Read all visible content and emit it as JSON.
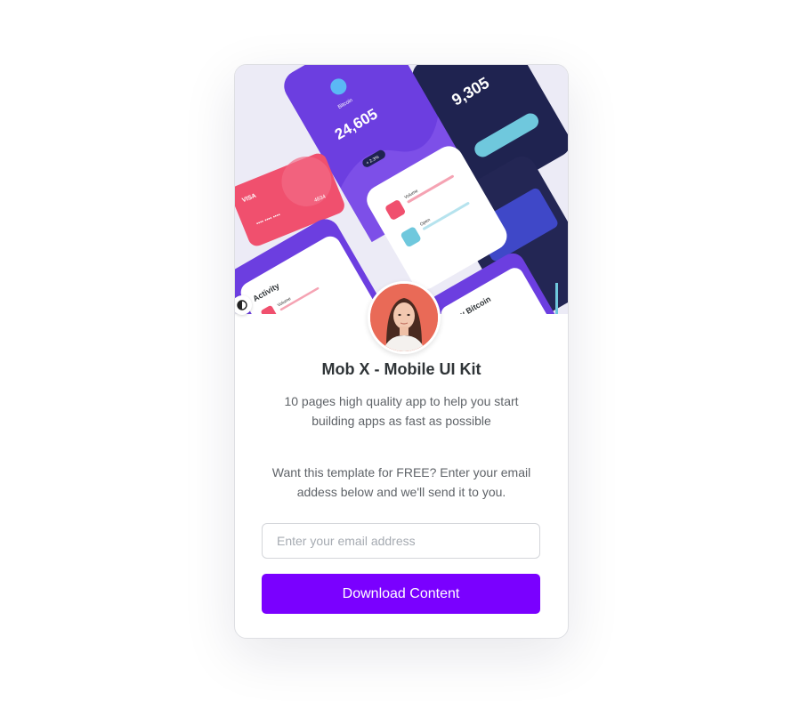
{
  "hero": {
    "showcase_screens": {
      "bitcoin_balance": "24,605",
      "bitcoin_label": "Bitcoin",
      "wallet_balance": "9,305",
      "card_brand": "VISA",
      "card_digits": "4834",
      "activity_title": "Activity",
      "volume_label": "Volume",
      "open_label": "Open",
      "buy_label": "Buy Bitcoin",
      "trend_badge": "+ 2.3%"
    },
    "image_icon": "app-screens-collage",
    "theme_toggle_icon": "contrast-icon"
  },
  "avatar": {
    "icon": "woman-portrait"
  },
  "product": {
    "title": "Mob X - Mobile UI Kit",
    "description": "10 pages high quality app to help you start building apps as fast as possible"
  },
  "signup": {
    "prompt": "Want this template for FREE? Enter your email addess below and we'll send it to you.",
    "email_placeholder": "Enter your email address",
    "email_value": "",
    "button_label": "Download Content"
  },
  "colors": {
    "accent": "#7a00ff",
    "hero_purple": "#6c3ee0",
    "card_pink": "#f0506e",
    "navy": "#1f2350",
    "avatar_bg": "#e96a57"
  }
}
